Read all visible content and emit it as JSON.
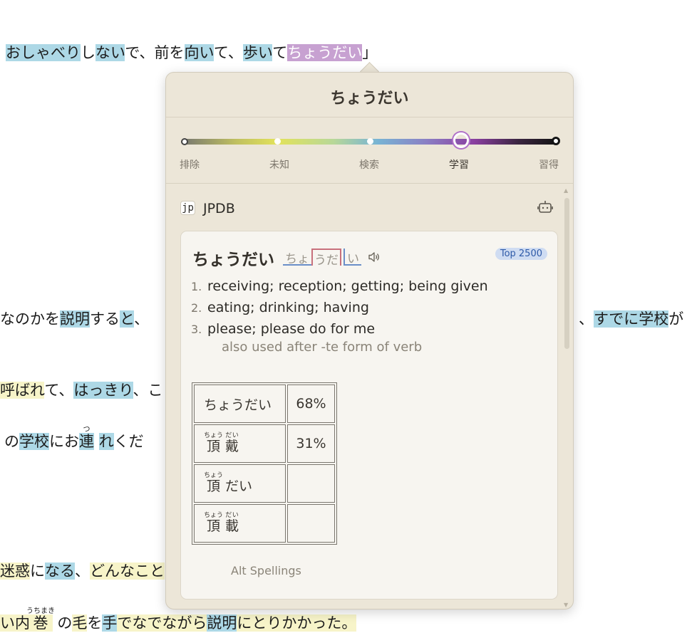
{
  "background_text": {
    "line1": {
      "s1": "おしゃべり",
      "s2": "し",
      "s3": "ない",
      "s4": "で、前を",
      "s5": "向い",
      "s6": "て、",
      "s7": "歩い",
      "s8": "て",
      "s9": "ちょうだい",
      "s10": "」"
    },
    "line2": {
      "s1": "なのかを",
      "s2": "説明",
      "s3": "する",
      "s4": "と",
      "s5": "、",
      "s6": "、",
      "s7": "すでに",
      "s8": "学校",
      "s9": "が"
    },
    "line3": {
      "s1": "呼ばれ",
      "s2": "て、",
      "s3": "はっきり",
      "s4": "、こ"
    },
    "line4": {
      "s1": "の",
      "s2": "学校",
      "s3": "にお",
      "s4": "連",
      "s4_rt": "つ",
      "s5": "れ",
      "s6": "くだ"
    },
    "line5": {
      "s1": "迷惑",
      "s2": "に",
      "s3": "なる",
      "s4": "、",
      "s5": "どんな",
      "s6": "こと"
    },
    "line6": {
      "s1": "い",
      "s2": "内",
      "s3": "巻",
      "s3_rt": "うちまき",
      "s4": "の",
      "s5": "毛",
      "s6": "を",
      "s7": "手",
      "s8": "でなでながら",
      "s9": "説明",
      "s10": "にとりかかった。"
    }
  },
  "popup": {
    "title": "ちょうだい",
    "slider": {
      "labels": [
        "排除",
        "未知",
        "検索",
        "学習",
        "習得"
      ],
      "selected_index": 3,
      "selected": "学習"
    },
    "source": {
      "logo": "jp",
      "name": "JPDB",
      "icon": "robot-icon"
    },
    "card": {
      "word": "ちょうだい",
      "pitch": {
        "a": "ちょ",
        "b": "うだ",
        "c": "い"
      },
      "badge": "Top 2500",
      "definitions": [
        {
          "num": "1.",
          "text": "receiving; reception; getting; being given"
        },
        {
          "num": "2.",
          "text": "eating; drinking; having"
        },
        {
          "num": "3.",
          "text": "please; please do for me"
        }
      ],
      "note": "also used after -te form of verb",
      "alt_spellings": [
        {
          "kana": "ちょうだい",
          "percent": "68%"
        },
        {
          "kanji1": "頂",
          "rt1": "ちょう",
          "kanji2": "戴",
          "rt2": "だい",
          "percent": "31%"
        },
        {
          "kanji1": "頂",
          "rt1": "ちょう",
          "rest": "だい",
          "percent": ""
        },
        {
          "kanji1": "頂",
          "rt1": "ちょう",
          "kanji2": "載",
          "rt2": "だい",
          "percent": ""
        }
      ],
      "alt_caption": "Alt Spellings"
    }
  },
  "colors": {
    "known_highlight": "#add8e6",
    "unknown_highlight": "#f7f4c9",
    "learning_highlight": "#c7a1d1",
    "popup_bg": "#ece6d8",
    "badge_bg": "#cfdcf2"
  }
}
